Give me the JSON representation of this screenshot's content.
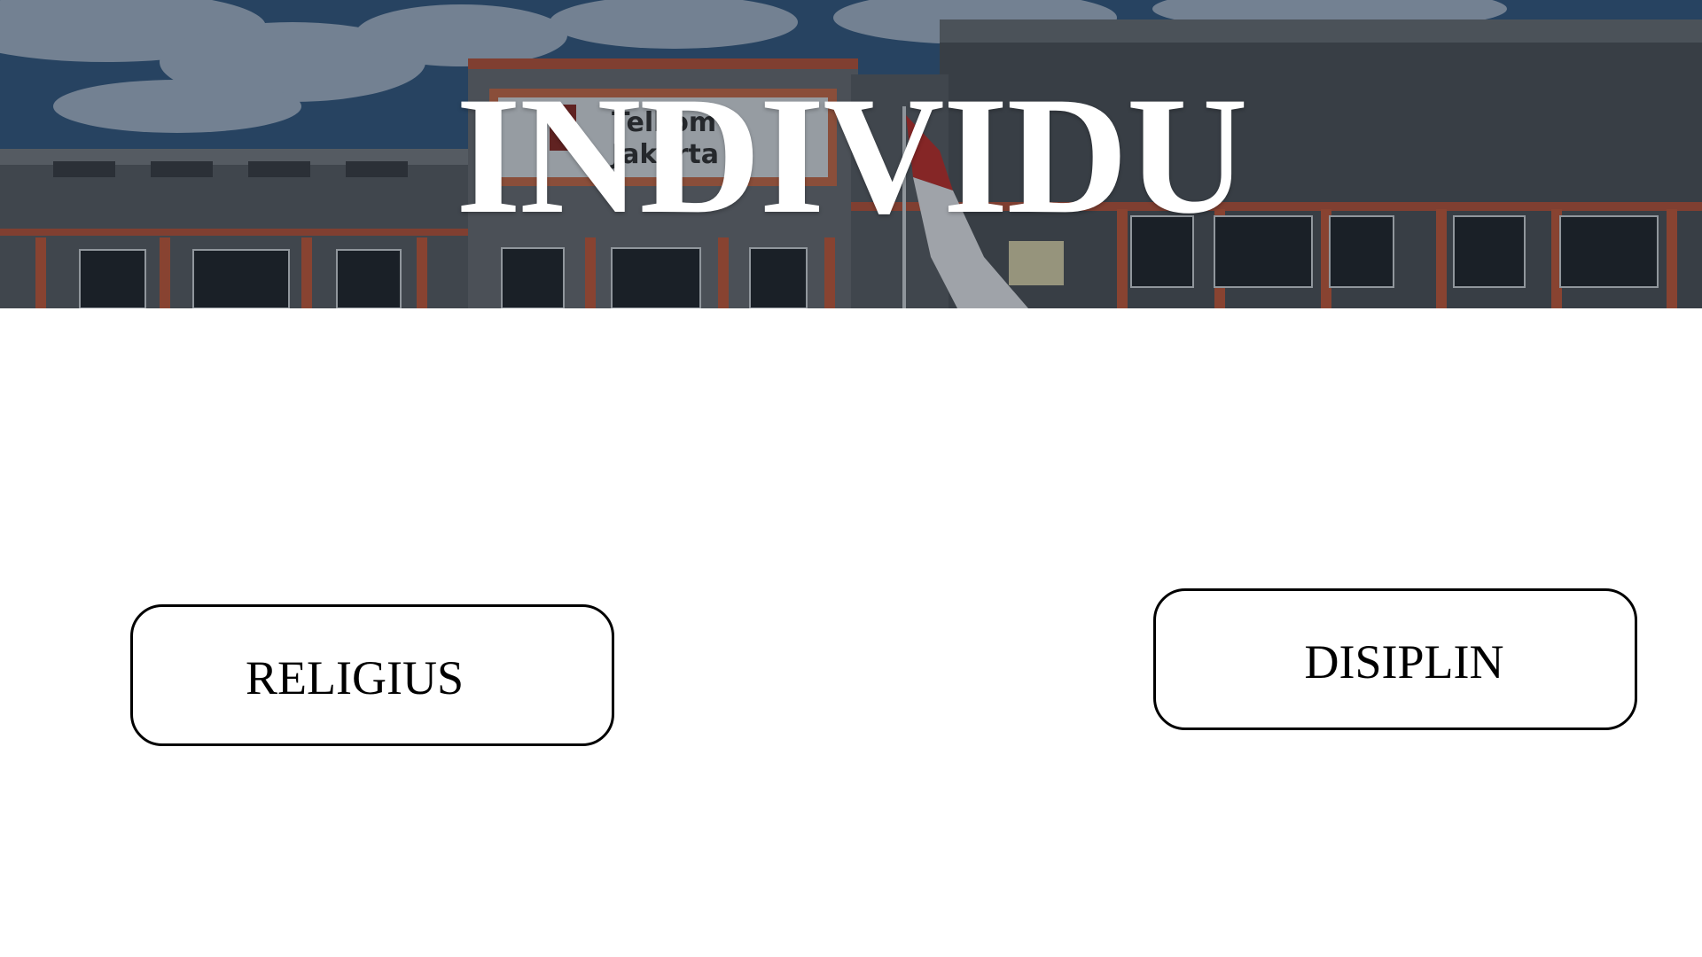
{
  "banner": {
    "title": "INDIVIDU",
    "signage_text": "SMK Telkom Jakarta"
  },
  "buttons": {
    "left_label": "RELIGIUS",
    "right_label": "DISIPLIN"
  },
  "colors": {
    "background": "#ffffff",
    "title_text": "#ffffff",
    "button_border": "#000000",
    "button_text": "#000000"
  }
}
